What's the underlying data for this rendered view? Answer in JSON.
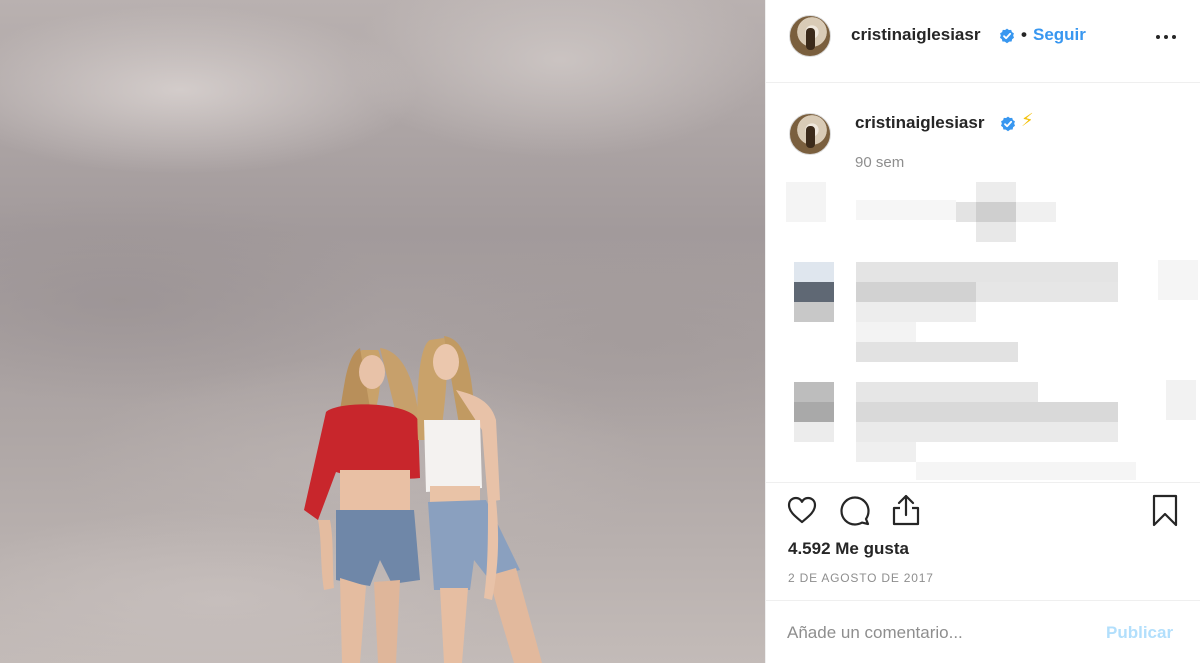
{
  "post": {
    "username": "cristinaiglesiasr",
    "verified": true,
    "separator": "•",
    "follow_label": "Seguir",
    "more_icon": "more-options-icon"
  },
  "caption": {
    "username": "cristinaiglesiasr",
    "emoji": "⚡",
    "age": "90 sem"
  },
  "actions": {
    "icons": [
      "heart-icon",
      "comment-icon",
      "share-icon",
      "bookmark-icon"
    ],
    "likes": "4.592 Me gusta",
    "date": "2 DE AGOSTO DE 2017"
  },
  "comment_box": {
    "placeholder": "Añade un comentario...",
    "publish_label": "Publicar"
  },
  "colors": {
    "accent": "#3897f0",
    "publish_disabled": "#b2dffc",
    "verified_badge": "#3897f0",
    "secondary_text": "#8e8e8e"
  }
}
